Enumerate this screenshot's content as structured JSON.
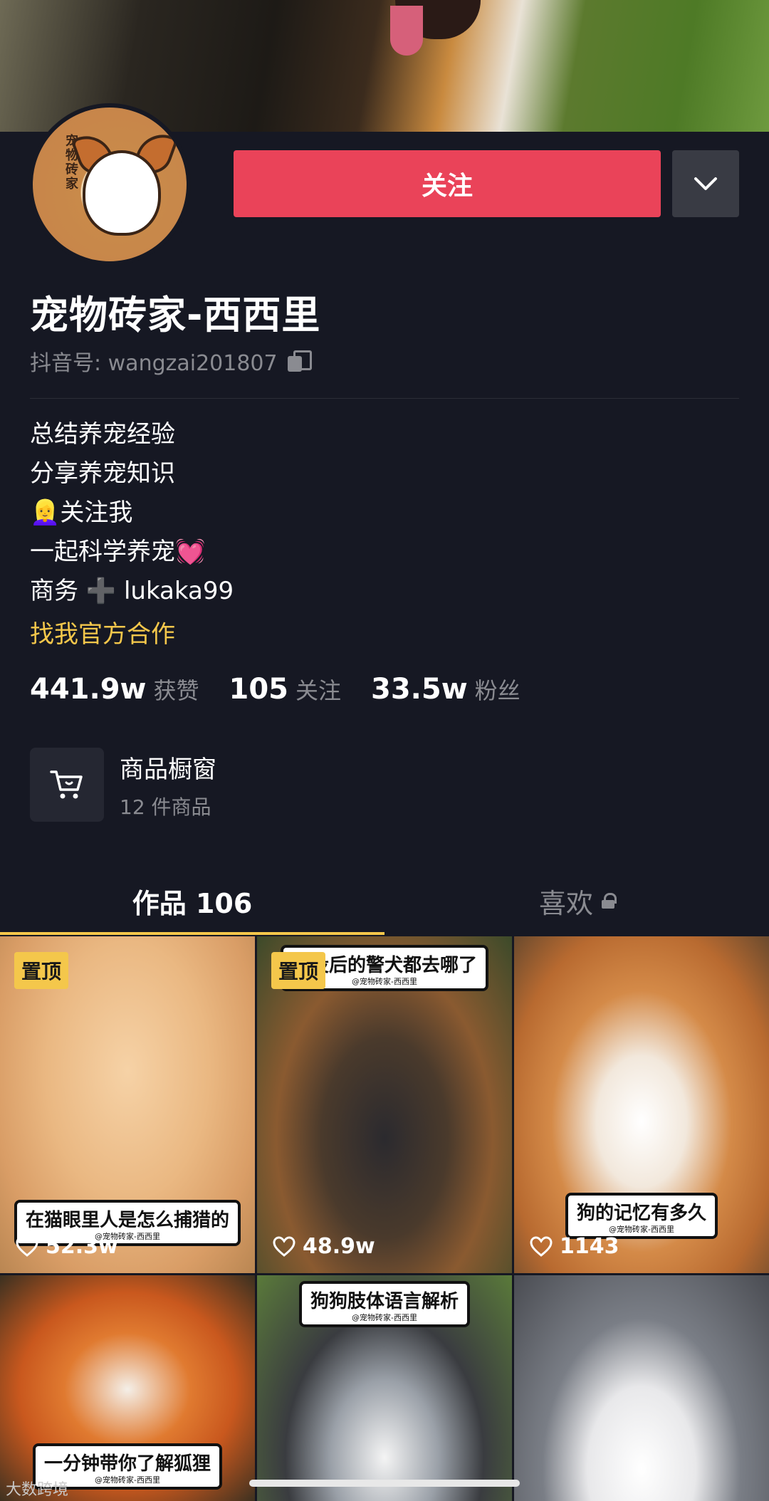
{
  "profile": {
    "follow_label": "关注",
    "name": "宠物砖家-西西里",
    "douyin_id": "抖音号: wangzai201807",
    "avatar_text": "宠物砖家"
  },
  "bio": {
    "lines": [
      "总结养宠经验",
      "分享养宠知识",
      "👱‍♀️关注我",
      "一起科学养宠💓"
    ],
    "biz_prefix": "商务",
    "biz_plus": "➕",
    "biz_contact": "lukaka99",
    "coop_link": "找我官方合作"
  },
  "stats": {
    "likes_num": "441.9w",
    "likes_label": "获赞",
    "following_num": "105",
    "following_label": "关注",
    "fans_num": "33.5w",
    "fans_label": "粉丝"
  },
  "shop": {
    "title": "商品橱窗",
    "subtitle": "12 件商品"
  },
  "tabs": {
    "works": "作品 106",
    "likes": "喜欢"
  },
  "videos": [
    {
      "pinned": "置顶",
      "caption": "在猫眼里人是怎么捕猎的",
      "caption_sub": "@宠物砖家-西西里",
      "likes": "52.3w"
    },
    {
      "pinned": "置顶",
      "caption": "退役后的警犬都去哪了",
      "caption_sub": "@宠物砖家-西西里",
      "likes": "48.9w"
    },
    {
      "caption": "狗的记忆有多久",
      "caption_sub": "@宠物砖家-西西里",
      "likes": "1143"
    },
    {
      "caption": "一分钟带你了解狐狸",
      "caption_sub": "@宠物砖家-西西里"
    },
    {
      "caption": "狗狗肢体语言解析",
      "caption_sub": "@宠物砖家-西西里"
    },
    {}
  ],
  "watermark": "大数跨境",
  "colors": {
    "accent": "#ea4359",
    "background": "#161823",
    "link": "#f4c74b",
    "muted": "#8a8b91"
  }
}
